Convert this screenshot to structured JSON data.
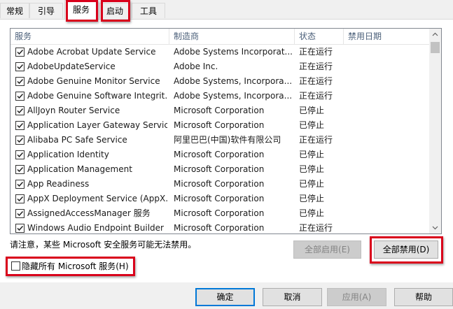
{
  "tabs": [
    {
      "label": "常规"
    },
    {
      "label": "引导"
    },
    {
      "label": "服务"
    },
    {
      "label": "启动"
    },
    {
      "label": "工具"
    }
  ],
  "columns": {
    "service": "服务",
    "manufacturer": "制造商",
    "status": "状态",
    "disabled_date": "禁用日期"
  },
  "services": [
    {
      "name": "Adobe Acrobat Update Service",
      "manufacturer": "Adobe Systems Incorporat...",
      "status": "正在运行",
      "checked": true
    },
    {
      "name": "AdobeUpdateService",
      "manufacturer": "Adobe Inc.",
      "status": "正在运行",
      "checked": true
    },
    {
      "name": "Adobe Genuine Monitor Service",
      "manufacturer": "Adobe Systems, Incorpora...",
      "status": "正在运行",
      "checked": true
    },
    {
      "name": "Adobe Genuine Software Integrit...",
      "manufacturer": "Adobe Systems, Incorpora...",
      "status": "正在运行",
      "checked": true
    },
    {
      "name": "AllJoyn Router Service",
      "manufacturer": "Microsoft Corporation",
      "status": "已停止",
      "checked": true
    },
    {
      "name": "Application Layer Gateway Service",
      "manufacturer": "Microsoft Corporation",
      "status": "已停止",
      "checked": true
    },
    {
      "name": "Alibaba PC Safe Service",
      "manufacturer": "阿里巴巴(中国)软件有限公司",
      "status": "正在运行",
      "checked": true
    },
    {
      "name": "Application Identity",
      "manufacturer": "Microsoft Corporation",
      "status": "已停止",
      "checked": true
    },
    {
      "name": "Application Management",
      "manufacturer": "Microsoft Corporation",
      "status": "已停止",
      "checked": true
    },
    {
      "name": "App Readiness",
      "manufacturer": "Microsoft Corporation",
      "status": "已停止",
      "checked": true
    },
    {
      "name": "AppX Deployment Service (AppX...",
      "manufacturer": "Microsoft Corporation",
      "status": "已停止",
      "checked": true
    },
    {
      "name": "AssignedAccessManager 服务",
      "manufacturer": "Microsoft Corporation",
      "status": "已停止",
      "checked": true
    },
    {
      "name": "Windows Audio Endpoint Builder",
      "manufacturer": "Microsoft Corporation",
      "status": "正在运行",
      "checked": true
    }
  ],
  "note": "请注意，某些 Microsoft 安全服务可能无法禁用。",
  "enable_all": "全部启用(E)",
  "disable_all": "全部禁用(D)",
  "hide_ms_label": "隐藏所有 Microsoft 服务(H)",
  "hide_ms_checked": false,
  "footer": {
    "ok": "确定",
    "cancel": "取消",
    "apply": "应用(A)",
    "help": "帮助"
  },
  "colors": {
    "highlight": "#d9001b",
    "header_text": "#4c607a"
  }
}
